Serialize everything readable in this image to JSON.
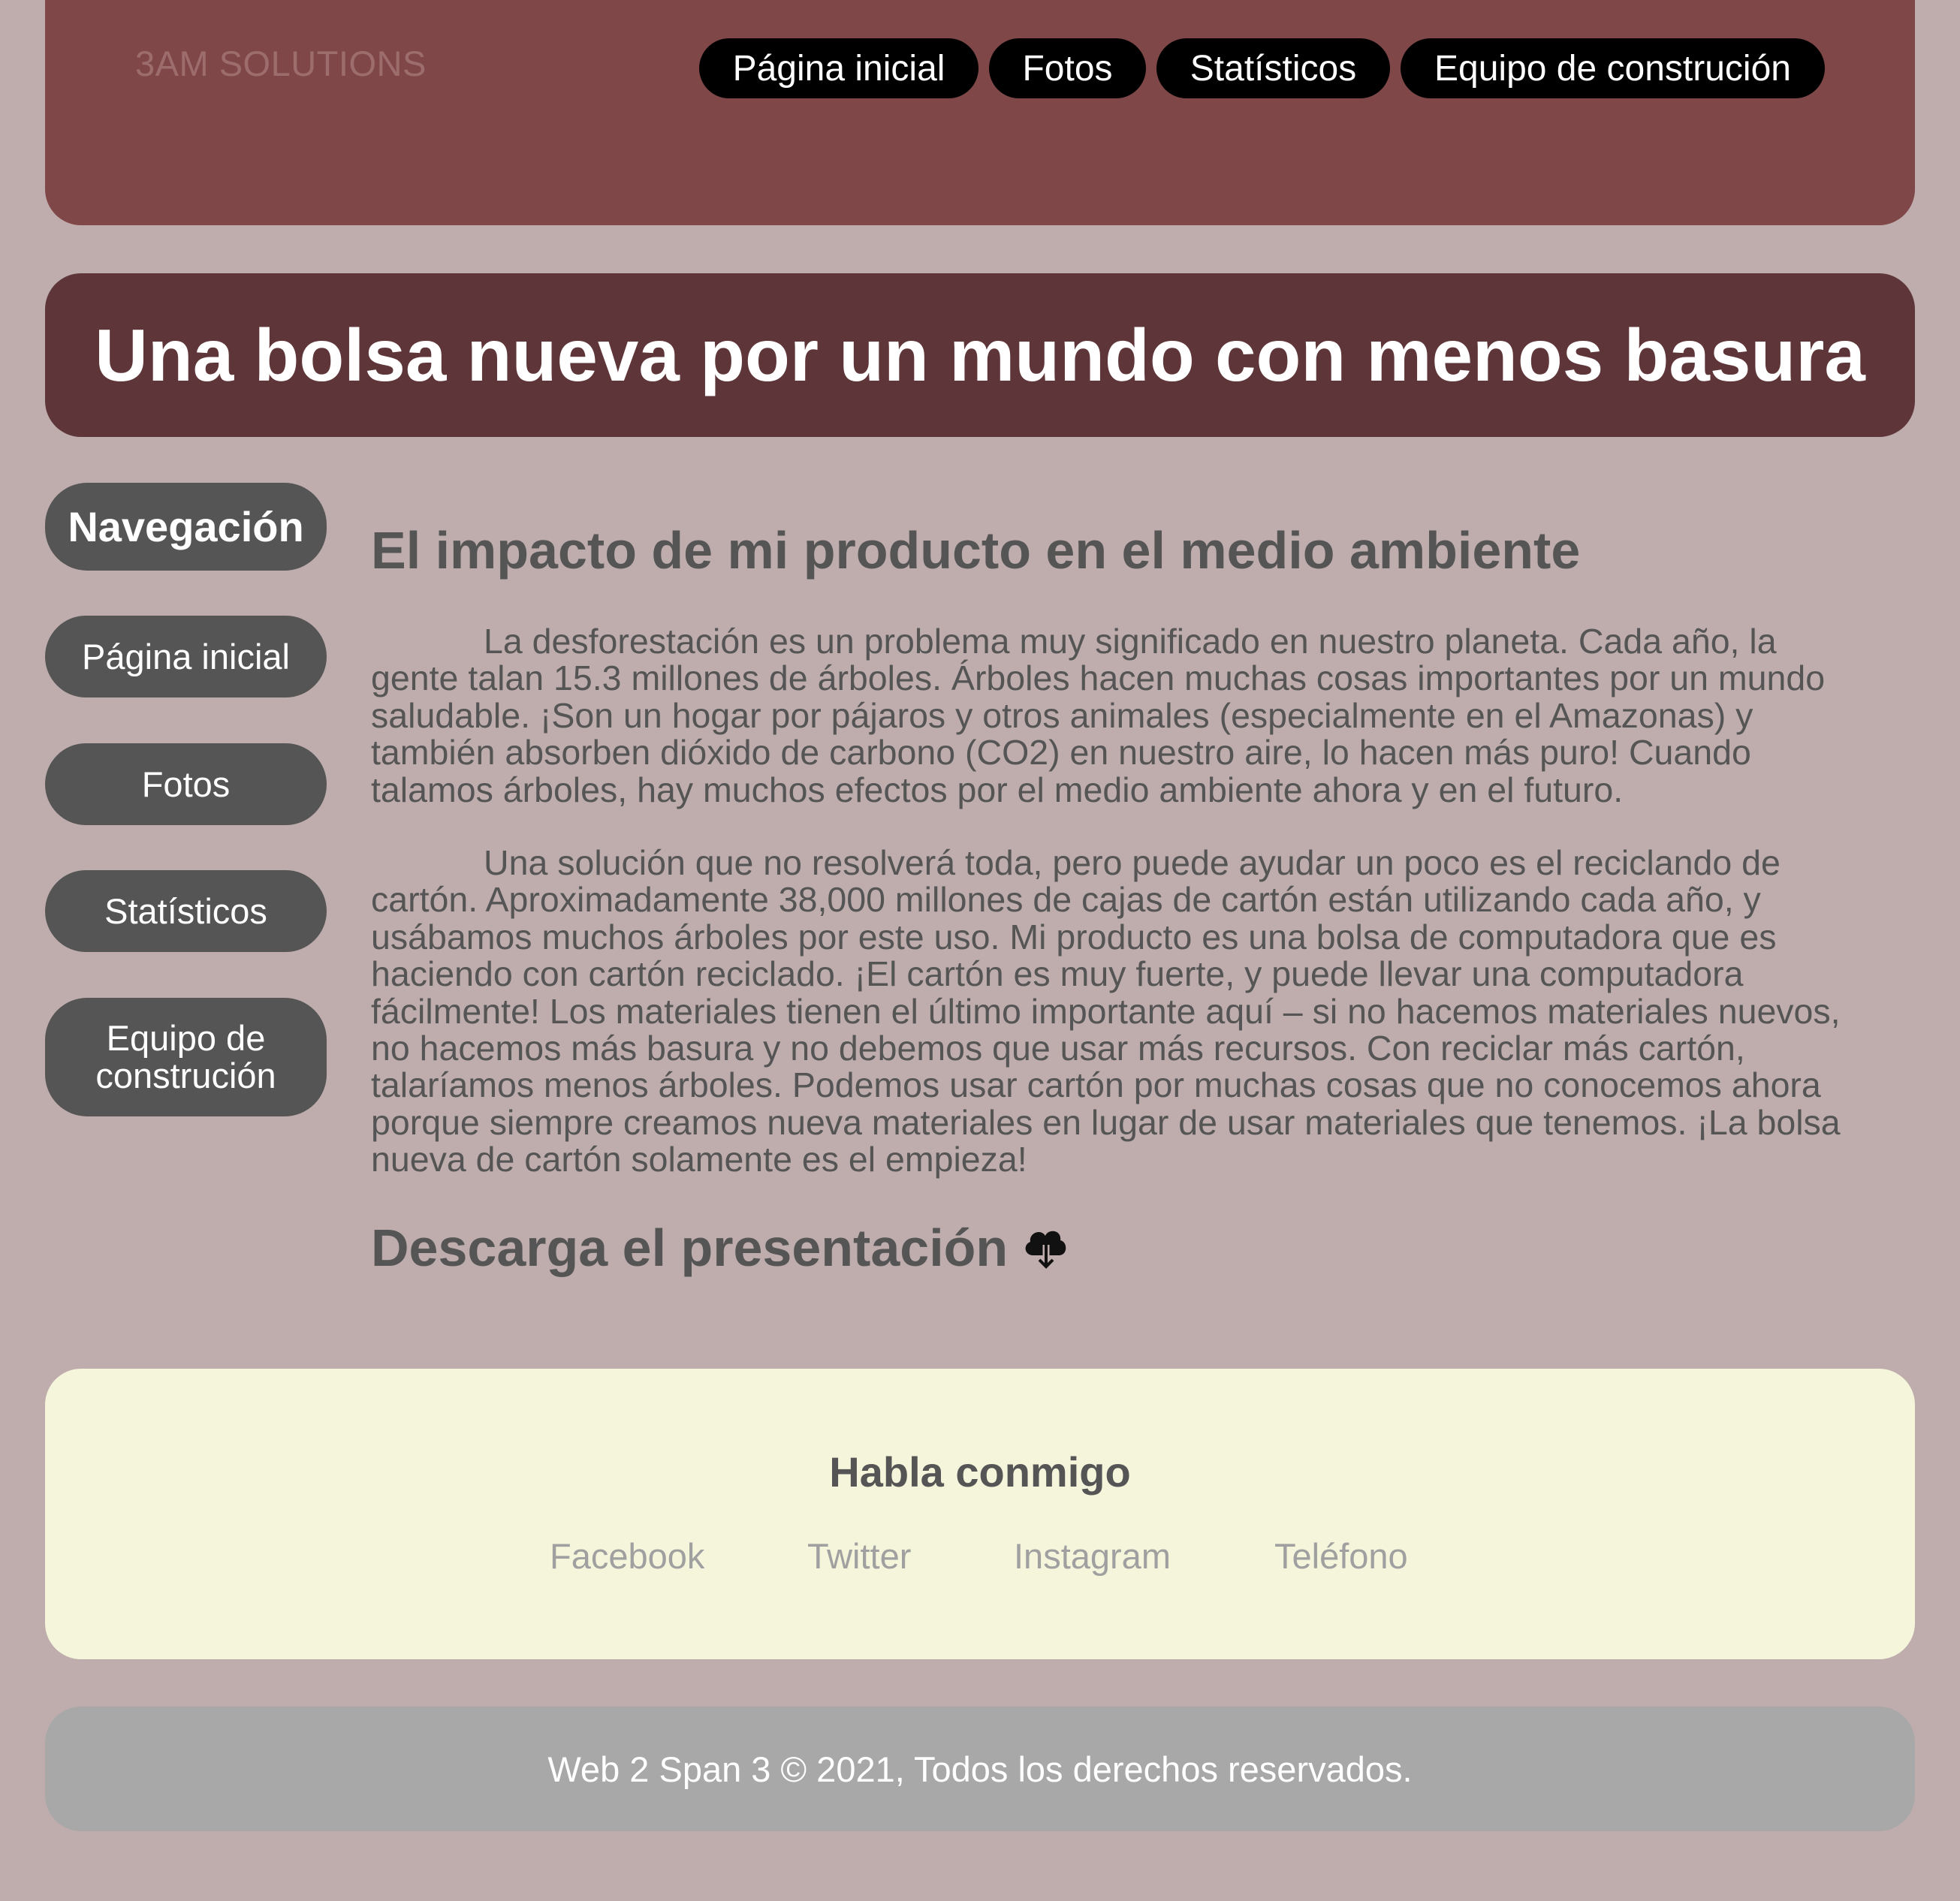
{
  "header": {
    "brand": "3AM SOLUTIONS",
    "nav": [
      "Página inicial",
      "Fotos",
      "Statísticos",
      "Equipo de construción"
    ]
  },
  "banner": {
    "title": "Una bolsa nueva por un mundo con menos basura"
  },
  "sidebar": {
    "heading": "Navegación",
    "items": [
      "Página inicial",
      "Fotos",
      "Statísticos",
      "Equipo de construción"
    ]
  },
  "main": {
    "heading": "El impacto de mi producto en el medio ambiente",
    "paragraphs": [
      "La desforestación es un problema muy significado en nuestro planeta. Cada año, la gente talan 15.3 millones de árboles. Árboles hacen muchas cosas importantes por un mundo saludable. ¡Son un hogar por pájaros y otros animales (especialmente en el Amazonas) y también absorben dióxido de carbono (CO2) en nuestro aire, lo hacen más puro! Cuando talamos árboles, hay muchos efectos por el medio ambiente ahora y en el futuro.",
      "Una solución que no resolverá toda, pero puede ayudar un poco es el reciclando de cartón. Aproximadamente 38,000 millones de cajas de cartón están utilizando cada año, y usábamos muchos árboles por este uso. Mi producto es una bolsa de computadora que es haciendo con cartón reciclado. ¡El cartón es muy fuerte, y puede llevar una computadora fácilmente! Los materiales tienen el último importante aquí – si no hacemos materiales nuevos, no hacemos más basura y no debemos que usar más recursos. Con reciclar más cartón, talaríamos menos árboles. Podemos usar cartón por muchas cosas que no conocemos ahora porque siempre creamos nueva materiales en lugar de usar materiales que tenemos. ¡La bolsa nueva de cartón solamente es el empieza!"
    ],
    "download_label": "Descarga el presentación",
    "download_icon": "cloud-download-icon"
  },
  "contact": {
    "title": "Habla conmigo",
    "links": [
      "Facebook",
      "Twitter",
      "Instagram",
      "Teléfono"
    ]
  },
  "footer": {
    "copyright": "Web 2 Span 3 © 2021, Todos los derechos reservados."
  },
  "colors": {
    "page_bg": "#bfadad",
    "header_bg": "#804748",
    "banner_bg": "#5e3538",
    "sidebar_bg": "#555555",
    "contact_bg": "#f5f5dc",
    "footer_bg": "#a8a8a8"
  }
}
